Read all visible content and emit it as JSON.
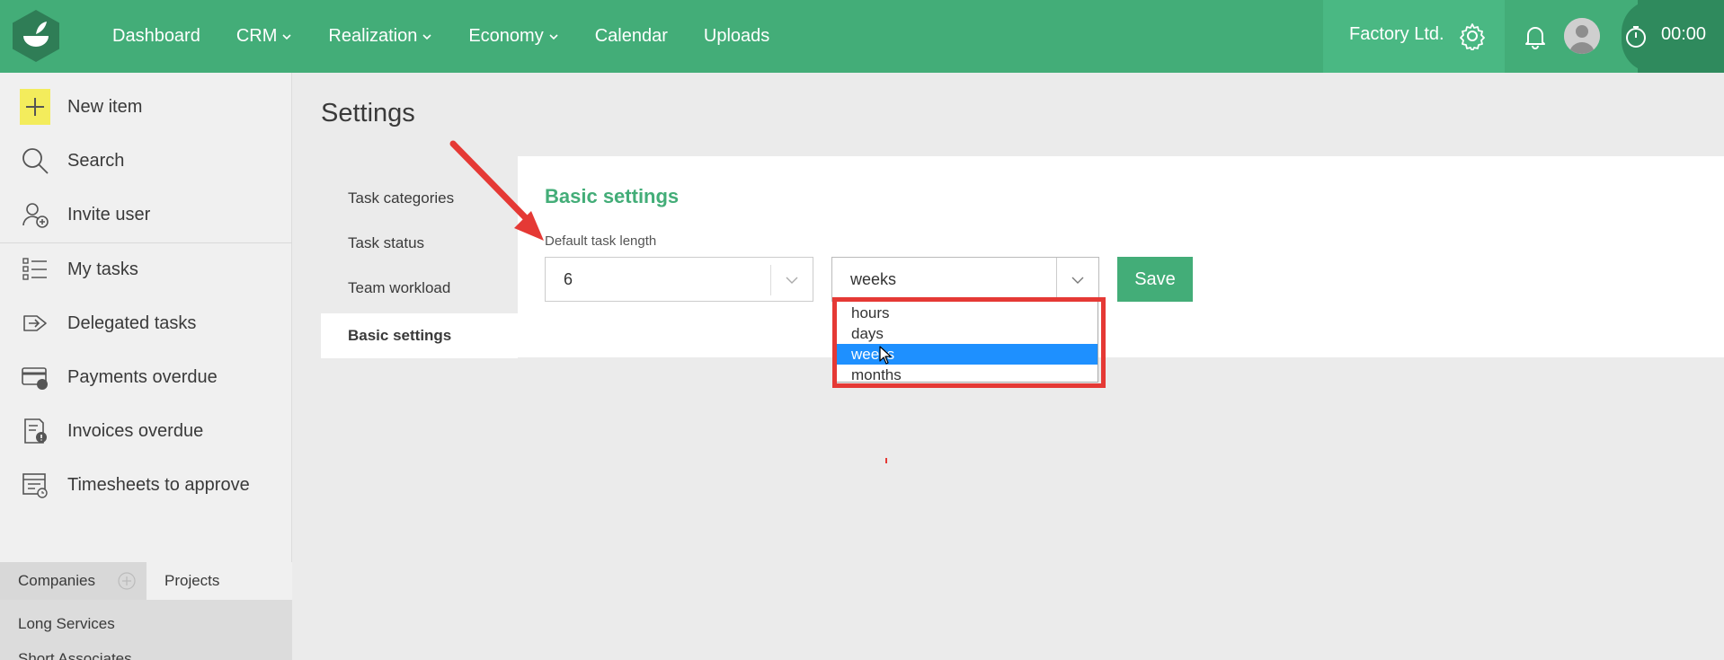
{
  "nav": {
    "items": [
      {
        "label": "Dashboard",
        "dropdown": false
      },
      {
        "label": "CRM",
        "dropdown": true
      },
      {
        "label": "Realization",
        "dropdown": true
      },
      {
        "label": "Economy",
        "dropdown": true
      },
      {
        "label": "Calendar",
        "dropdown": false
      },
      {
        "label": "Uploads",
        "dropdown": false
      }
    ],
    "company": "Factory Ltd.",
    "timer": "00:00"
  },
  "sidebar": {
    "items": [
      {
        "label": "New item",
        "icon": "plus-icon"
      },
      {
        "label": "Search",
        "icon": "search-icon"
      },
      {
        "label": "Invite user",
        "icon": "invite-user-icon"
      },
      {
        "label": "My tasks",
        "icon": "task-list-icon"
      },
      {
        "label": "Delegated tasks",
        "icon": "delegate-icon"
      },
      {
        "label": "Payments overdue",
        "icon": "payment-card-icon"
      },
      {
        "label": "Invoices overdue",
        "icon": "invoice-alert-icon"
      },
      {
        "label": "Timesheets to approve",
        "icon": "timesheet-icon"
      }
    ],
    "tabs": {
      "companies": "Companies",
      "projects": "Projects"
    },
    "companies": [
      "Long Services",
      "Short Associates"
    ]
  },
  "main": {
    "title": "Settings",
    "settings_nav": [
      {
        "label": "Task categories",
        "active": false
      },
      {
        "label": "Task status",
        "active": false
      },
      {
        "label": "Team workload",
        "active": false
      },
      {
        "label": "Basic settings",
        "active": true
      }
    ],
    "section_title": "Basic settings",
    "field_label": "Default task length",
    "length_value": "6",
    "unit_value": "weeks",
    "unit_options": [
      {
        "label": "hours",
        "selected": false
      },
      {
        "label": "days",
        "selected": false
      },
      {
        "label": "weeks",
        "selected": true
      },
      {
        "label": "months",
        "selected": false
      }
    ],
    "save_label": "Save"
  },
  "colors": {
    "brand_green": "#43ad78",
    "highlight_red": "#e53935",
    "selection_blue": "#1e90ff"
  }
}
